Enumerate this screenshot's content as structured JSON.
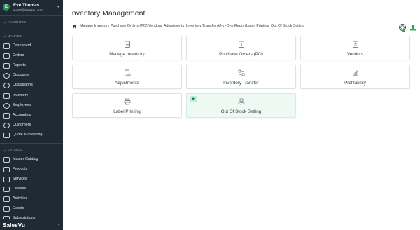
{
  "user": {
    "initial": "E",
    "name": "Eve Thomas",
    "email": "eve90@salesvu.com"
  },
  "sidebar": {
    "favorites_label": "FAVORITES",
    "manage_label": "MANAGE",
    "manage_items": [
      {
        "label": "Dashboard",
        "icon": "dashboard-icon"
      },
      {
        "label": "Orders",
        "icon": "orders-icon"
      },
      {
        "label": "Reports",
        "icon": "reports-icon"
      },
      {
        "label": "Discounts",
        "icon": "discounts-icon"
      },
      {
        "label": "Discussions",
        "icon": "discussions-icon"
      },
      {
        "label": "Inventory",
        "icon": "inventory-icon"
      },
      {
        "label": "Employees",
        "icon": "employees-icon"
      },
      {
        "label": "Accounting",
        "icon": "accounting-icon"
      },
      {
        "label": "Customers",
        "icon": "customers-icon"
      },
      {
        "label": "Quote & Invoicing",
        "icon": "quote-icon"
      }
    ],
    "catalog_label": "CATALOG",
    "catalog_items": [
      {
        "label": "Master Catalog",
        "icon": "master-catalog-icon"
      },
      {
        "label": "Products",
        "icon": "products-icon"
      },
      {
        "label": "Services",
        "icon": "services-icon"
      },
      {
        "label": "Classes",
        "icon": "classes-icon"
      },
      {
        "label": "Activities",
        "icon": "activities-icon"
      },
      {
        "label": "Events",
        "icon": "events-icon"
      },
      {
        "label": "Subscriptions",
        "icon": "subscriptions-icon"
      }
    ],
    "brand": "SalesVu"
  },
  "page": {
    "title": "Inventory Management"
  },
  "tabs": [
    "Manage Inventory",
    "Purchase Orders (PO)",
    "Vendors",
    "Adjustments",
    "Inventory Transfer",
    "All-in-One Report",
    "Label Printing",
    "Out Of Stock Setting"
  ],
  "cards": [
    {
      "label": "Manage Inventory",
      "icon": "clipboard-list-icon"
    },
    {
      "label": "Purchase Orders (PO)",
      "icon": "purchase-order-icon"
    },
    {
      "label": "Vendors",
      "icon": "vendor-document-icon"
    },
    {
      "label": "Adjustments",
      "icon": "adjustments-icon"
    },
    {
      "label": "Inventory Transfer",
      "icon": "transfer-icon"
    },
    {
      "label": "Profitability",
      "icon": "bar-chart-icon"
    },
    {
      "label": "Label Printing",
      "icon": "label-print-icon"
    },
    {
      "label": "Out Of Stock Setting",
      "icon": "box-hand-icon",
      "favorite": true
    }
  ],
  "colors": {
    "sidebar_bg": "#1e2b35",
    "accent_green": "#27a94d",
    "highlight_card_bg": "#eef9f3"
  }
}
